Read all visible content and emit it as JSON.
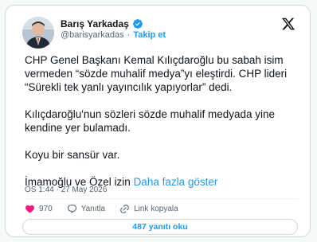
{
  "author": {
    "name": "Barış Yarkadaş",
    "handle": "@barisyarkadas",
    "follow_label": "Takip et"
  },
  "tweet": {
    "paragraphs": [
      "CHP Genel Başkanı Kemal Kılıçdaroğlu bu sabah isim vermeden “sözde muhalif medya”yı eleştirdi.  CHP lideri “Sürekli tek yanlı yayıncılık yapıyorlar” dedi.",
      "Kılıçdaroğlu'nun sözleri sözde muhalif medyada yine kendine yer bulamadı.",
      "Koyu bir sansür var."
    ],
    "last_line": "İmamoğlu ve Özel izin ",
    "show_more_label": "Daha fazla göster",
    "timestamp": "ÖS 1:44 · 27 May 2026"
  },
  "actions": {
    "like_count": "970",
    "reply_label": "Yanıtla",
    "copy_link_label": "Link kopyala"
  },
  "replies_button_label": "487 yanıtı oku",
  "colors": {
    "accent": "#1d9bf0",
    "like": "#f91880",
    "text": "#0f1419",
    "muted": "#536471"
  },
  "icons": [
    "verified-badge-icon",
    "x-logo-icon",
    "heart-icon",
    "reply-icon",
    "link-icon"
  ]
}
